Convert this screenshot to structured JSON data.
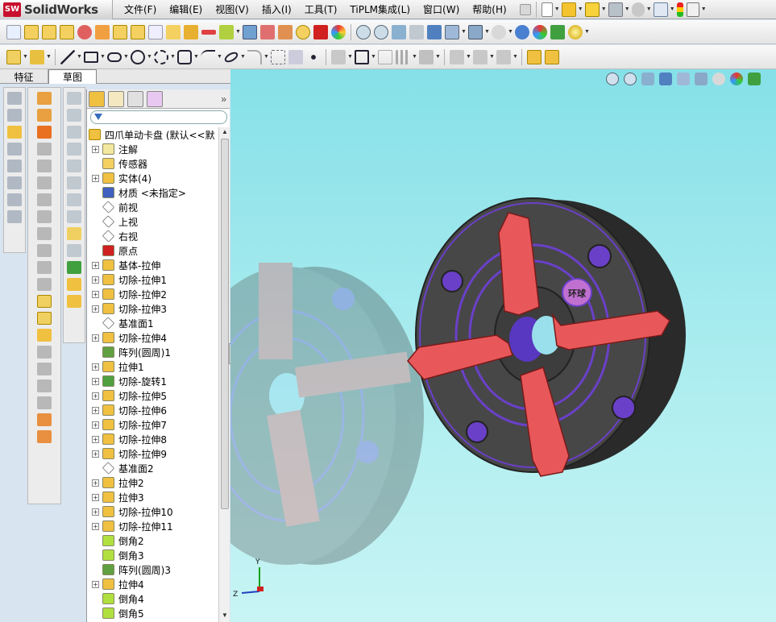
{
  "app": {
    "logo_badge": "SW",
    "name": "SolidWorks"
  },
  "menu": {
    "items": [
      "文件(F)",
      "编辑(E)",
      "视图(V)",
      "插入(I)",
      "工具(T)",
      "TiPLM集成(L)",
      "窗口(W)",
      "帮助(H)"
    ]
  },
  "tabs": {
    "feature": "特征",
    "sketch": "草图",
    "active": "草图"
  },
  "tree": {
    "root": "四爪单动卡盘 (默认<<默",
    "items": [
      {
        "label": "注解",
        "expand": true,
        "icon": "annotation-icon"
      },
      {
        "label": "传感器",
        "expand": false,
        "icon": "sensor-icon"
      },
      {
        "label": "实体(4)",
        "expand": true,
        "icon": "solid-bodies-icon"
      },
      {
        "label": "材质 <未指定>",
        "expand": false,
        "icon": "material-icon"
      },
      {
        "label": "前视",
        "expand": false,
        "icon": "plane-icon"
      },
      {
        "label": "上视",
        "expand": false,
        "icon": "plane-icon"
      },
      {
        "label": "右视",
        "expand": false,
        "icon": "plane-icon"
      },
      {
        "label": "原点",
        "expand": false,
        "icon": "origin-icon"
      },
      {
        "label": "基体-拉伸",
        "expand": true,
        "icon": "extrude-icon"
      },
      {
        "label": "切除-拉伸1",
        "expand": true,
        "icon": "cut-extrude-icon"
      },
      {
        "label": "切除-拉伸2",
        "expand": true,
        "icon": "cut-extrude-icon"
      },
      {
        "label": "切除-拉伸3",
        "expand": true,
        "icon": "cut-extrude-icon"
      },
      {
        "label": "基准面1",
        "expand": false,
        "icon": "plane-icon"
      },
      {
        "label": "切除-拉伸4",
        "expand": true,
        "icon": "cut-extrude-icon"
      },
      {
        "label": "阵列(圆周)1",
        "expand": false,
        "icon": "circular-pattern-icon"
      },
      {
        "label": "拉伸1",
        "expand": true,
        "icon": "extrude-icon"
      },
      {
        "label": "切除-旋转1",
        "expand": true,
        "icon": "cut-revolve-icon"
      },
      {
        "label": "切除-拉伸5",
        "expand": true,
        "icon": "cut-extrude-icon"
      },
      {
        "label": "切除-拉伸6",
        "expand": true,
        "icon": "cut-extrude-icon"
      },
      {
        "label": "切除-拉伸7",
        "expand": true,
        "icon": "cut-extrude-icon"
      },
      {
        "label": "切除-拉伸8",
        "expand": true,
        "icon": "cut-extrude-icon"
      },
      {
        "label": "切除-拉伸9",
        "expand": true,
        "icon": "cut-extrude-icon"
      },
      {
        "label": "基准面2",
        "expand": false,
        "icon": "plane-icon"
      },
      {
        "label": "拉伸2",
        "expand": true,
        "icon": "extrude-icon"
      },
      {
        "label": "拉伸3",
        "expand": true,
        "icon": "extrude-icon"
      },
      {
        "label": "切除-拉伸10",
        "expand": true,
        "icon": "cut-extrude-icon"
      },
      {
        "label": "切除-拉伸11",
        "expand": true,
        "icon": "cut-extrude-icon"
      },
      {
        "label": "倒角2",
        "expand": false,
        "icon": "chamfer-icon"
      },
      {
        "label": "倒角3",
        "expand": false,
        "icon": "chamfer-icon"
      },
      {
        "label": "阵列(圆周)3",
        "expand": false,
        "icon": "circular-pattern-icon"
      },
      {
        "label": "拉伸4",
        "expand": true,
        "icon": "extrude-icon"
      },
      {
        "label": "倒角4",
        "expand": false,
        "icon": "chamfer-icon"
      },
      {
        "label": "倒角5",
        "expand": false,
        "icon": "chamfer-icon"
      }
    ]
  },
  "viewport": {
    "part_emboss_text": "环球",
    "triad": {
      "x": "",
      "y": "Y",
      "z": "Z"
    },
    "colors": {
      "body": "#4a4a4a",
      "jaw": "#e8585a",
      "ring": "#6a40c8",
      "bg_top": "#86e0e8",
      "bg_bottom": "#c8f4f4"
    }
  }
}
